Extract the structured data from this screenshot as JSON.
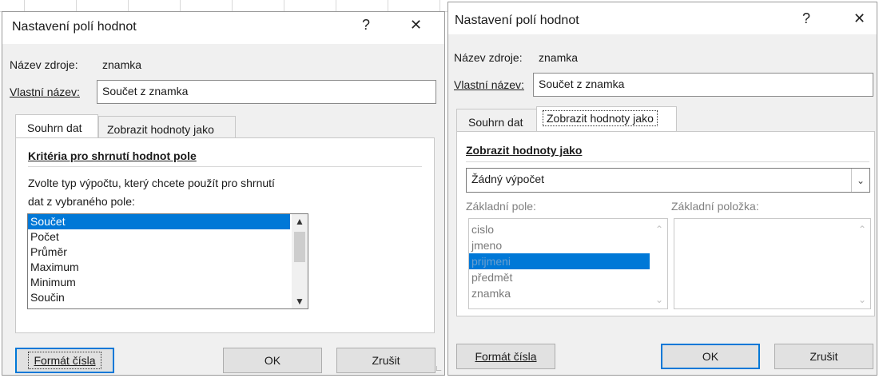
{
  "left_dialog": {
    "title": "Nastavení polí hodnot",
    "help": "?",
    "close": "✕",
    "source_label": "Název zdroje:",
    "source_value": "znamka",
    "custom_name_label": "Vlastní název:",
    "custom_name_value": "Součet z znamka",
    "tabs": [
      "Souhrn dat",
      "Zobrazit hodnoty jako"
    ],
    "section_heading": "Kritéria pro shrnutí hodnot pole",
    "description_line1": "Zvolte typ výpočtu, který chcete použít pro shrnutí",
    "description_line2": "dat z vybraného pole:",
    "functions": [
      "Součet",
      "Počet",
      "Průměr",
      "Maximum",
      "Minimum",
      "Součin"
    ],
    "selected_function": "Součet",
    "number_format_button": "Formát čísla",
    "ok_button": "OK",
    "cancel_button": "Zrušit"
  },
  "right_dialog": {
    "title": "Nastavení polí hodnot",
    "help": "?",
    "close": "✕",
    "source_label": "Název zdroje:",
    "source_value": "znamka",
    "custom_name_label": "Vlastní název:",
    "custom_name_value": "Součet z znamka",
    "tabs": [
      "Souhrn dat",
      "Zobrazit hodnoty jako"
    ],
    "section_heading": "Zobrazit hodnoty jako",
    "calculation_value": "Žádný výpočet",
    "base_field_label": "Základní pole:",
    "base_item_label": "Základní položka:",
    "base_fields": [
      "cislo",
      "jmeno",
      "prijmeni",
      "předmět",
      "znamka"
    ],
    "selected_base_field": "prijmeni",
    "number_format_button": "Formát čísla",
    "ok_button": "OK",
    "cancel_button": "Zrušit"
  },
  "colors": {
    "selection": "#0078d7",
    "dialog_bg": "#f0f0f0",
    "titlebar_bg": "#ffffff"
  }
}
